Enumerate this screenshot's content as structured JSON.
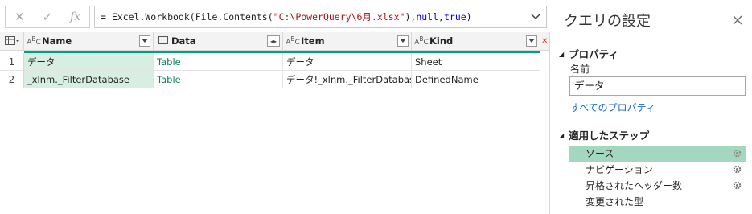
{
  "formula_bar": {
    "cancel_icon": "x-icon",
    "confirm_icon": "check-icon",
    "fx_label": "fx",
    "prefix": "= Excel.Workbook(File.Contents(",
    "path": "\"C:\\PowerQuery\\6月.xlsx\"",
    "middle": "), ",
    "arg1": "null",
    "sep": ", ",
    "arg2": "true",
    "suffix": ")"
  },
  "grid": {
    "columns": [
      {
        "name": "Name",
        "type_icon": "ABC"
      },
      {
        "name": "Data",
        "type_icon": "table"
      },
      {
        "name": "Item",
        "type_icon": "ABC"
      },
      {
        "name": "Kind",
        "type_icon": "ABC"
      }
    ],
    "rows": [
      {
        "index": "1",
        "name": "データ",
        "data": "Table",
        "item": "データ",
        "kind": "Sheet"
      },
      {
        "index": "2",
        "name": "_xlnm._FilterDatabase",
        "data": "Table",
        "item": "データ!_xlnm._FilterDatabase",
        "kind": "DefinedName"
      }
    ]
  },
  "pane": {
    "title": "クエリの設定",
    "properties_heading": "プロパティ",
    "name_label": "名前",
    "name_value": "データ",
    "all_properties_link": "すべてのプロパティ",
    "steps_heading": "適用したステップ",
    "steps": [
      {
        "label": "ソース",
        "has_gear": true,
        "selected": true
      },
      {
        "label": "ナビゲーション",
        "has_gear": true,
        "selected": false
      },
      {
        "label": "昇格されたヘッダー数",
        "has_gear": true,
        "selected": false
      },
      {
        "label": "変更された型",
        "has_gear": false,
        "selected": false
      }
    ]
  },
  "colors": {
    "accent": "#00a088",
    "selected_cell": "#d7efe2",
    "selected_step": "#a4d7bf",
    "link": "#1a6bbf"
  }
}
